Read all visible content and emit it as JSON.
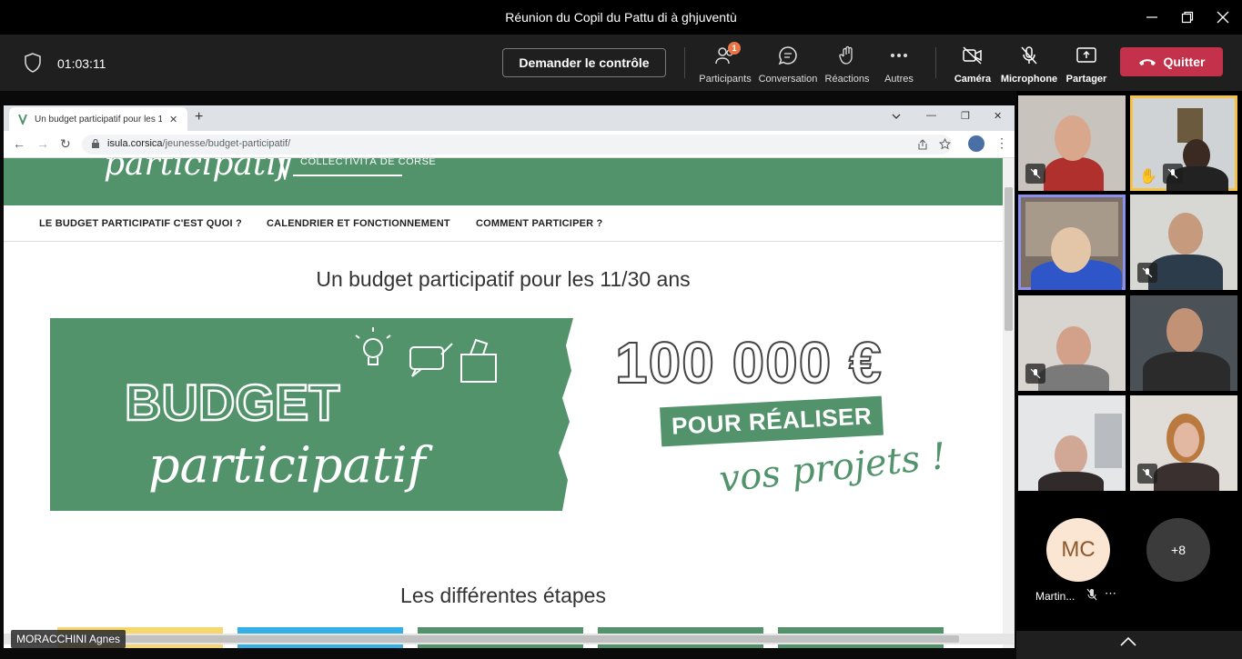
{
  "window": {
    "title": "Réunion du Copil du Pattu di à ghjuventù"
  },
  "toolbar": {
    "timer": "01:03:11",
    "request_control": "Demander le contrôle",
    "participants_label": "Participants",
    "participants_badge": "1",
    "conversation_label": "Conversation",
    "reactions_label": "Réactions",
    "more_label": "Autres",
    "camera_label": "Caméra",
    "microphone_label": "Microphone",
    "share_label": "Partager",
    "quit_label": "Quitter"
  },
  "browser": {
    "tab_title": "Un budget participatif pour les 1",
    "url_domain": "isula.corsica",
    "url_path": "/jeunesse/budget-participatif/"
  },
  "site": {
    "logo_text": "participatif",
    "collectivite": "COLLECTIVITÀ DE CORSE",
    "nav": [
      "LE BUDGET PARTICIPATIF C'EST QUOI ?",
      "CALENDRIER ET FONCTIONNEMENT",
      "COMMENT PARTICIPER ?"
    ],
    "heading": "Un budget participatif pour les 11/30 ans",
    "banner_line1": "BUDGET",
    "banner_line2": "participatif",
    "amount": "100 000 €",
    "realiser": "POUR RÉALISER",
    "projets": "vos projets !",
    "steps_heading": "Les différentes étapes",
    "step_colors": [
      "#f5d76e",
      "#33b0e6",
      "#52936c",
      "#52936c",
      "#52936c"
    ]
  },
  "presenter_name": "MORACCHINI Agnes",
  "roster": {
    "avatar_initials": "MC",
    "avatar_name": "Martin...",
    "more_count": "+8"
  },
  "colors": {
    "accent_green": "#52936c",
    "quit_red": "#c4314b",
    "badge_orange": "#e97548",
    "speaker_yellow": "#f6c344",
    "pinned_purple": "#8a8ff0"
  }
}
